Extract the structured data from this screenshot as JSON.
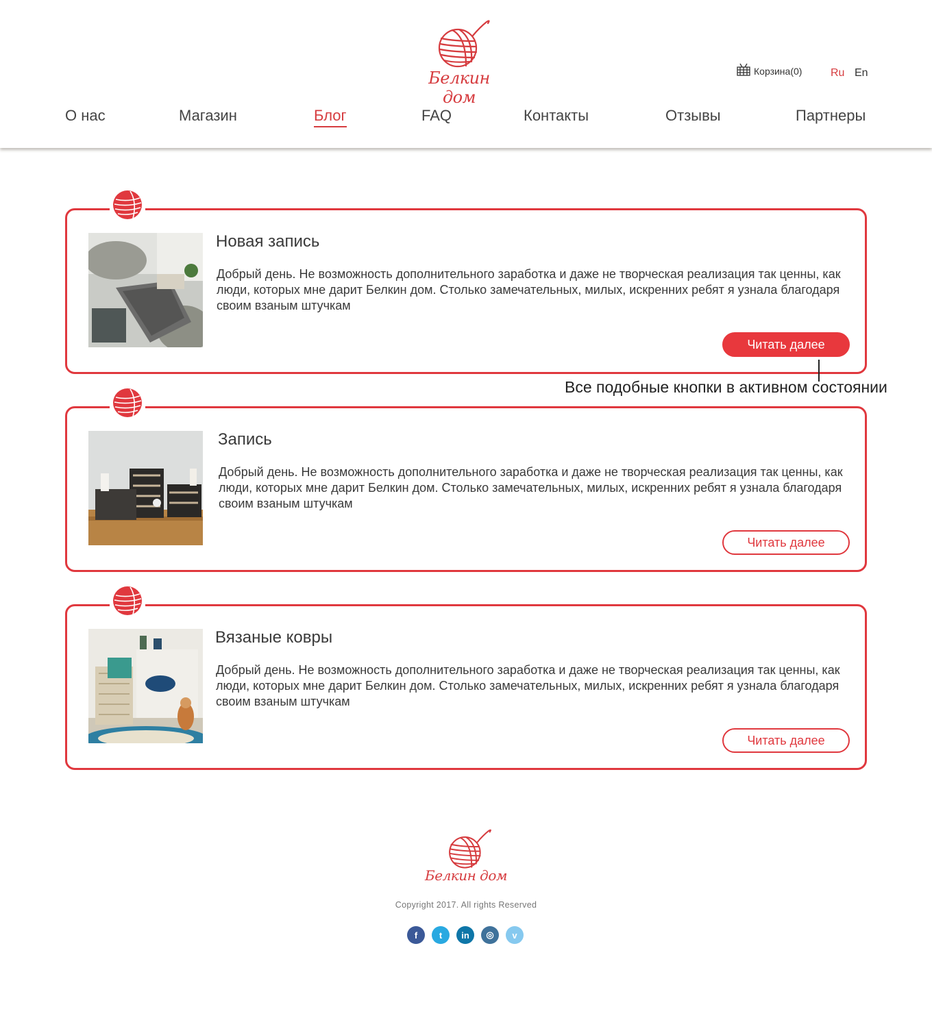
{
  "brand": {
    "name": "Белкин дом",
    "accent_color": "#e0383e"
  },
  "header": {
    "cart_label": "Корзина(0)",
    "cart_icon": "basket-icon",
    "languages": [
      {
        "label": "Ru",
        "active": true
      },
      {
        "label": "En",
        "active": false
      }
    ]
  },
  "nav": {
    "items": [
      {
        "label": "О нас"
      },
      {
        "label": "Магазин"
      },
      {
        "label": "Блог",
        "active": true
      },
      {
        "label": "FAQ"
      },
      {
        "label": "Контакты"
      },
      {
        "label": "Отзывы"
      },
      {
        "label": "Партнеры"
      }
    ]
  },
  "posts": [
    {
      "title": "Новая запись",
      "text": "Добрый день. Не возможность дополнительного заработка  и даже не творческая реализация так ценны, как люди, которых мне дарит Белкин дом. Столько замечательных, милых, искренних ребят я узнала благодаря своим взаным штучкам",
      "button": "Читать далее",
      "button_state": "active"
    },
    {
      "title": "Запись",
      "text": "Добрый день. Не возможность дополнительного заработка  и даже не творческая реализация так ценны, как люди, которых мне дарит Белкин дом. Столько замечательных, милых, искренних ребят я узнала благодаря своим взаным штучкам",
      "button": "Читать далее",
      "button_state": "default"
    },
    {
      "title": "Вязаные ковры",
      "text": "Добрый день. Не возможность дополнительного заработка  и даже не творческая реализация так ценны, как люди, которых мне дарит Белкин дом. Столько замечательных, милых, искренних ребят я узнала благодаря своим взаным штучкам",
      "button": "Читать далее",
      "button_state": "default"
    }
  ],
  "annotation": "Все подобные кнопки в активном состоянии",
  "footer": {
    "copyright": "Copyright 2017. All rights Reserved",
    "socials": [
      {
        "icon": "facebook-icon",
        "glyph": "f",
        "color": "#3b5998"
      },
      {
        "icon": "twitter-icon",
        "glyph": "t",
        "color": "#29a9e1"
      },
      {
        "icon": "linkedin-icon",
        "glyph": "in",
        "color": "#0e76a8"
      },
      {
        "icon": "instagram-icon",
        "glyph": "◎",
        "color": "#3f729b"
      },
      {
        "icon": "vimeo-icon",
        "glyph": "v",
        "color": "#86c9ef"
      }
    ]
  }
}
